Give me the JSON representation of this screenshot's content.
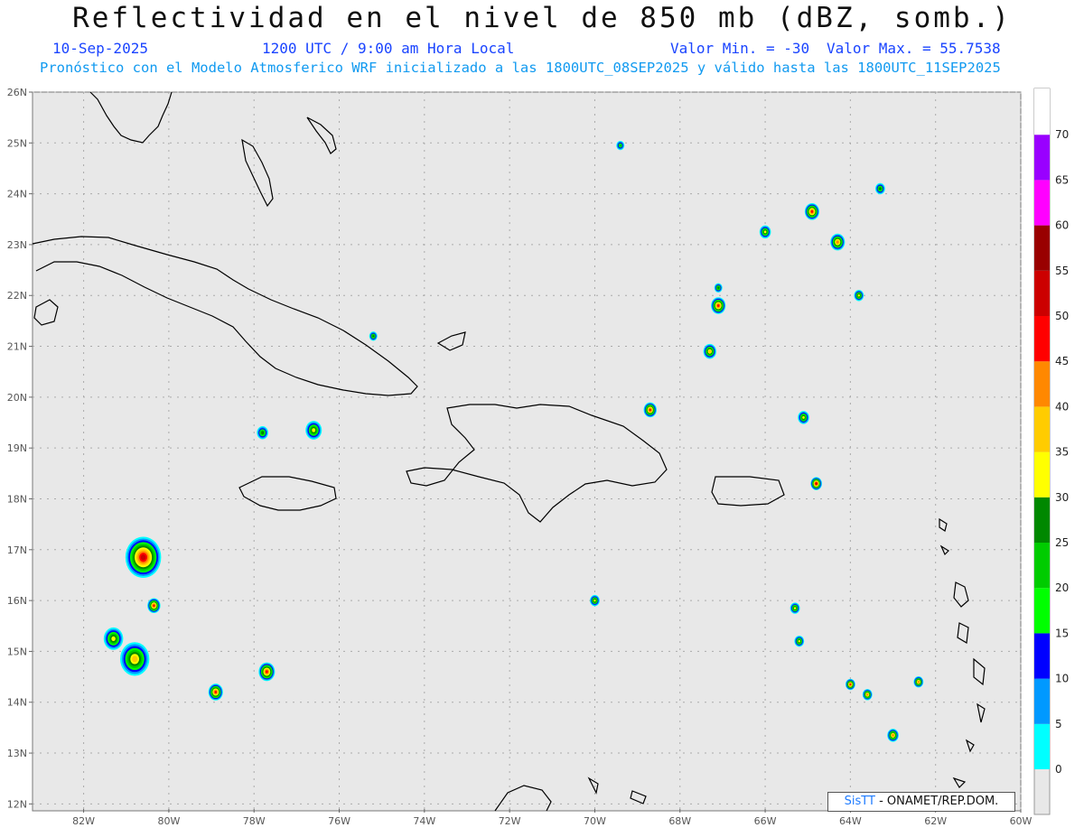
{
  "header": {
    "title": "Reflectividad en el nivel de 850 mb (dBZ, somb.)",
    "date": "10-Sep-2025",
    "time": "1200 UTC / 9:00 am Hora Local",
    "min_label": "Valor Min. = -30",
    "max_label": "Valor Max. = 55.7538",
    "forecast_info": "Pronóstico con el Modelo Atmosferico WRF inicializado a las 1800UTC_08SEP2025 y válido hasta las  1800UTC_11SEP2025"
  },
  "axes": {
    "lat_labels": [
      "26N",
      "25N",
      "24N",
      "23N",
      "22N",
      "21N",
      "20N",
      "19N",
      "18N",
      "17N",
      "16N",
      "15N",
      "14N",
      "13N",
      "12N"
    ],
    "lon_labels": [
      "82W",
      "80W",
      "78W",
      "76W",
      "74W",
      "72W",
      "70W",
      "68W",
      "66W",
      "64W",
      "62W",
      "60W"
    ]
  },
  "colorbar": {
    "labels": [
      "0",
      "5",
      "10",
      "15",
      "20",
      "25",
      "30",
      "35",
      "40",
      "45",
      "50",
      "55",
      "60",
      "65",
      "70"
    ],
    "colors": [
      "#00ffff",
      "#0099ff",
      "#0000ff",
      "#00ff00",
      "#00cc00",
      "#008800",
      "#ffff00",
      "#ffcc00",
      "#ff8800",
      "#ff0000",
      "#cc0000",
      "#990000",
      "#ff00ff",
      "#9900ff"
    ]
  },
  "credit": {
    "sis": "SisTT",
    "rest": " - ONAMET/REP.DOM."
  },
  "cells": [
    {
      "lon": -80.6,
      "lat": 16.85,
      "dbz": 50,
      "size": 2.2
    },
    {
      "lon": -80.8,
      "lat": 14.85,
      "dbz": 35,
      "size": 1.8
    },
    {
      "lon": -81.3,
      "lat": 15.25,
      "dbz": 30,
      "size": 1.2
    },
    {
      "lon": -80.35,
      "lat": 15.9,
      "dbz": 45,
      "size": 0.8
    },
    {
      "lon": -78.9,
      "lat": 14.2,
      "dbz": 45,
      "size": 0.9
    },
    {
      "lon": -77.7,
      "lat": 14.6,
      "dbz": 45,
      "size": 1.0
    },
    {
      "lon": -76.6,
      "lat": 19.35,
      "dbz": 30,
      "size": 1.0
    },
    {
      "lon": -77.8,
      "lat": 19.3,
      "dbz": 25,
      "size": 0.7
    },
    {
      "lon": -68.7,
      "lat": 19.75,
      "dbz": 45,
      "size": 0.8
    },
    {
      "lon": -64.9,
      "lat": 23.65,
      "dbz": 45,
      "size": 0.9
    },
    {
      "lon": -64.3,
      "lat": 23.05,
      "dbz": 40,
      "size": 0.9
    },
    {
      "lon": -67.1,
      "lat": 21.8,
      "dbz": 45,
      "size": 0.9
    },
    {
      "lon": -67.3,
      "lat": 20.9,
      "dbz": 35,
      "size": 0.8
    },
    {
      "lon": -65.1,
      "lat": 19.6,
      "dbz": 30,
      "size": 0.7
    },
    {
      "lon": -64.8,
      "lat": 18.3,
      "dbz": 50,
      "size": 0.7
    },
    {
      "lon": -66.0,
      "lat": 23.25,
      "dbz": 30,
      "size": 0.7
    },
    {
      "lon": -63.8,
      "lat": 22.0,
      "dbz": 30,
      "size": 0.6
    },
    {
      "lon": -63.3,
      "lat": 24.1,
      "dbz": 25,
      "size": 0.6
    },
    {
      "lon": -64.0,
      "lat": 14.35,
      "dbz": 45,
      "size": 0.6
    },
    {
      "lon": -63.6,
      "lat": 14.15,
      "dbz": 40,
      "size": 0.6
    },
    {
      "lon": -62.4,
      "lat": 14.4,
      "dbz": 40,
      "size": 0.6
    },
    {
      "lon": -63.0,
      "lat": 13.35,
      "dbz": 40,
      "size": 0.7
    },
    {
      "lon": -65.3,
      "lat": 15.85,
      "dbz": 30,
      "size": 0.6
    },
    {
      "lon": -65.2,
      "lat": 15.2,
      "dbz": 30,
      "size": 0.6
    },
    {
      "lon": -70.0,
      "lat": 16.0,
      "dbz": 30,
      "size": 0.6
    },
    {
      "lon": -75.2,
      "lat": 21.2,
      "dbz": 25,
      "size": 0.5
    },
    {
      "lon": -67.1,
      "lat": 22.15,
      "dbz": 25,
      "size": 0.5
    },
    {
      "lon": -69.4,
      "lat": 24.95,
      "dbz": 20,
      "size": 0.5
    }
  ]
}
